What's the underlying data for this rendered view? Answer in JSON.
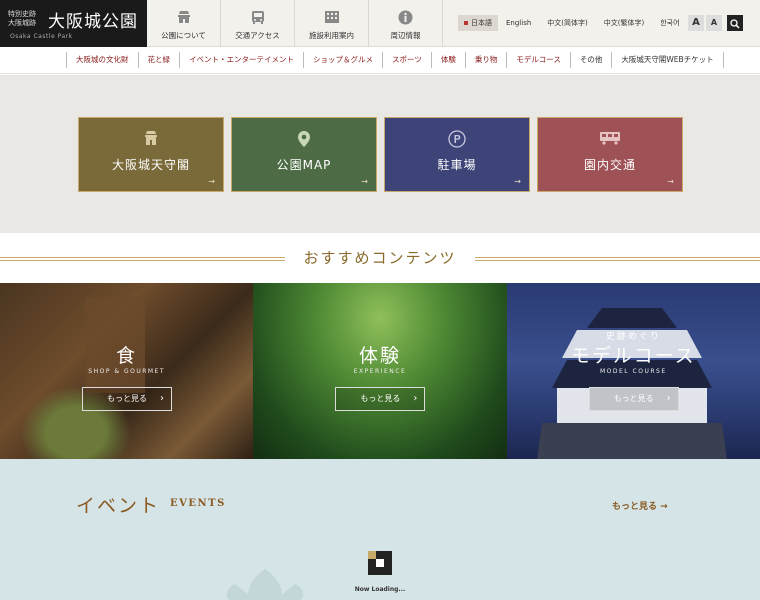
{
  "logo": {
    "sub": "特別史跡 大阪城跡",
    "main": "大阪城公園",
    "en": "Osaka Castle Park"
  },
  "mainnav": [
    {
      "label": "公園について",
      "icon": "castle-icon"
    },
    {
      "label": "交通アクセス",
      "icon": "bus-icon"
    },
    {
      "label": "施設利用案内",
      "icon": "building-icon"
    },
    {
      "label": "周辺情報",
      "icon": "info-icon"
    }
  ],
  "langs": [
    {
      "label": "日本語",
      "active": true
    },
    {
      "label": "English"
    },
    {
      "label": "中文(简体字)"
    },
    {
      "label": "中文(繁体字)"
    },
    {
      "label": "한국어"
    }
  ],
  "font_buttons": {
    "large": "A",
    "small": "A"
  },
  "subnav": [
    {
      "label": "大阪城の文化財"
    },
    {
      "label": "花と緑"
    },
    {
      "label": "イベント・エンターテイメント"
    },
    {
      "label": "ショップ＆グルメ"
    },
    {
      "label": "スポーツ"
    },
    {
      "label": "体験"
    },
    {
      "label": "乗り物"
    },
    {
      "label": "モデルコース"
    },
    {
      "label": "その他"
    },
    {
      "label": "大阪城天守閣WEBチケット"
    }
  ],
  "tiles": [
    {
      "label": "大阪城天守閣",
      "icon": "castle-icon",
      "color": "#7a6a3a",
      "arrow": "→"
    },
    {
      "label": "公園MAP",
      "icon": "map-pin-icon",
      "color": "#4d6b45",
      "arrow": "→"
    },
    {
      "label": "駐車場",
      "icon": "parking-icon",
      "color": "#3e4477",
      "arrow": "→"
    },
    {
      "label": "園内交通",
      "icon": "train-icon",
      "color": "#9e5256",
      "arrow": "→"
    }
  ],
  "recommended": {
    "title": "おすすめコンテンツ",
    "cards": [
      {
        "pre": "",
        "title": "食",
        "sub": "SHOP & GOURMET",
        "button": "もっと見る",
        "chev": "›"
      },
      {
        "pre": "",
        "title": "体験",
        "sub": "EXPERIENCE",
        "button": "もっと見る",
        "chev": "›"
      },
      {
        "pre": "史跡めぐり",
        "title": "モデルコース",
        "sub": "MODEL COURSE",
        "button": "もっと見る",
        "chev": "›"
      }
    ]
  },
  "events": {
    "title": "イベント",
    "en": "EVENTS",
    "more": "もっと見る →",
    "loading": "Now Loading..."
  },
  "colors": {
    "accent_gold": "#c9a96a",
    "accent_brown": "#8a5a22",
    "subnav_red": "#8a1c1c"
  }
}
